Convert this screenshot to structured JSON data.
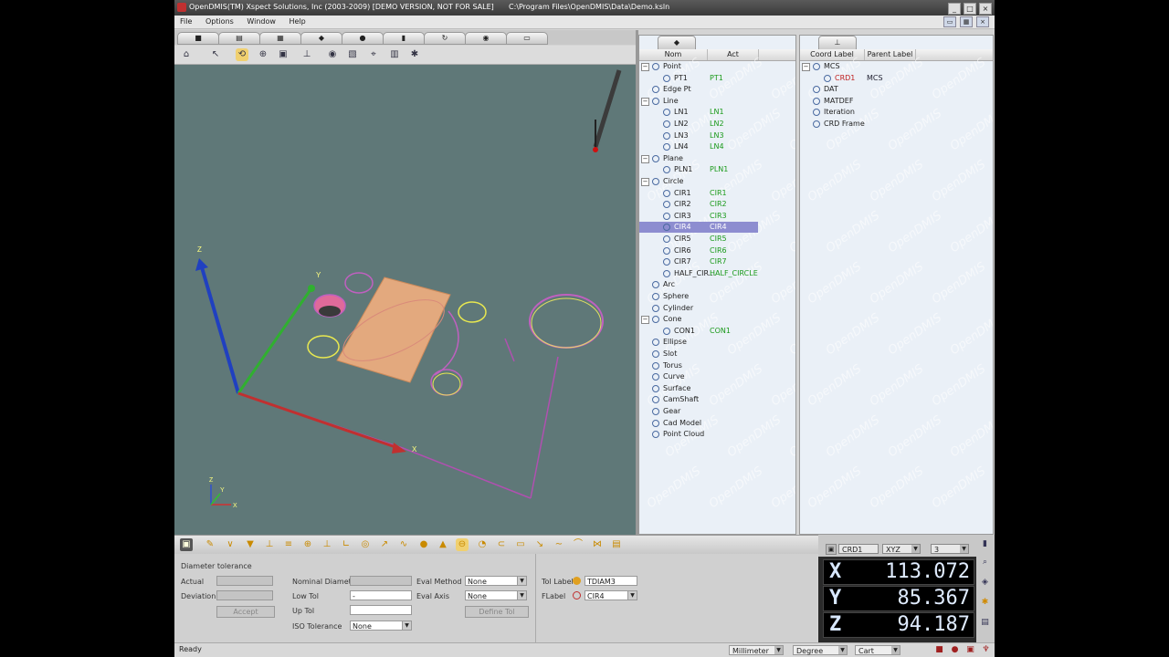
{
  "window": {
    "title": "OpenDMIS(TM)  Xspect Solutions, Inc  (2003-2009) [DEMO VERSION, NOT FOR SALE]",
    "path": "C:\\Program Files\\OpenDMIS\\Data\\Demo.ksln"
  },
  "menu": {
    "file": "File",
    "options": "Options",
    "window": "Window",
    "help": "Help"
  },
  "viewport": {
    "background": "#5f7878",
    "axis_labels": {
      "x": "X",
      "y": "Y",
      "z": "Z"
    }
  },
  "features_panel": {
    "col_name": "Nom",
    "col_act": "Act",
    "watermark": "OpenDMIS",
    "rows": [
      {
        "label": "Point",
        "act": "",
        "level": 0,
        "icon": "point-icon"
      },
      {
        "label": "PT1",
        "act": "PT1",
        "level": 1
      },
      {
        "label": "Edge Pt",
        "act": "",
        "level": 0,
        "icon": "edge-point-icon"
      },
      {
        "label": "Line",
        "act": "",
        "level": 0,
        "icon": "line-icon"
      },
      {
        "label": "LN1",
        "act": "LN1",
        "level": 1
      },
      {
        "label": "LN2",
        "act": "LN2",
        "level": 1
      },
      {
        "label": "LN3",
        "act": "LN3",
        "level": 1
      },
      {
        "label": "LN4",
        "act": "LN4",
        "level": 1
      },
      {
        "label": "Plane",
        "act": "",
        "level": 0,
        "icon": "plane-icon"
      },
      {
        "label": "PLN1",
        "act": "PLN1",
        "level": 1
      },
      {
        "label": "Circle",
        "act": "",
        "level": 0,
        "icon": "circle-icon"
      },
      {
        "label": "CIR1",
        "act": "CIR1",
        "level": 1
      },
      {
        "label": "CIR2",
        "act": "CIR2",
        "level": 1
      },
      {
        "label": "CIR3",
        "act": "CIR3",
        "level": 1
      },
      {
        "label": "CIR4",
        "act": "CIR4",
        "level": 1,
        "selected": true
      },
      {
        "label": "CIR5",
        "act": "CIR5",
        "level": 1
      },
      {
        "label": "CIR6",
        "act": "CIR6",
        "level": 1
      },
      {
        "label": "CIR7",
        "act": "CIR7",
        "level": 1
      },
      {
        "label": "HALF_CIR...",
        "act": "HALF_CIRCLE",
        "level": 1
      },
      {
        "label": "Arc",
        "act": "",
        "level": 0,
        "icon": "arc-icon"
      },
      {
        "label": "Sphere",
        "act": "",
        "level": 0,
        "icon": "sphere-icon"
      },
      {
        "label": "Cylinder",
        "act": "",
        "level": 0,
        "icon": "cylinder-icon"
      },
      {
        "label": "Cone",
        "act": "",
        "level": 0,
        "icon": "cone-icon"
      },
      {
        "label": "CON1",
        "act": "CON1",
        "level": 1
      },
      {
        "label": "Ellipse",
        "act": "",
        "level": 0,
        "icon": "ellipse-icon"
      },
      {
        "label": "Slot",
        "act": "",
        "level": 0,
        "icon": "slot-icon"
      },
      {
        "label": "Torus",
        "act": "",
        "level": 0,
        "icon": "torus-icon"
      },
      {
        "label": "Curve",
        "act": "",
        "level": 0,
        "icon": "curve-icon"
      },
      {
        "label": "Surface",
        "act": "",
        "level": 0,
        "icon": "surface-icon"
      },
      {
        "label": "CamShaft",
        "act": "",
        "level": 0,
        "icon": "camshaft-icon"
      },
      {
        "label": "Gear",
        "act": "",
        "level": 0,
        "icon": "gear-icon"
      },
      {
        "label": "Cad Model",
        "act": "",
        "level": 0,
        "icon": "cad-model-icon"
      },
      {
        "label": "Point Cloud",
        "act": "",
        "level": 0,
        "icon": "point-cloud-icon"
      }
    ]
  },
  "coord_panel": {
    "col_label": "Coord Label",
    "col_parent": "Parent Label",
    "rows": [
      {
        "label": "MCS",
        "parent": "",
        "level": 0
      },
      {
        "label": "CRD1",
        "parent": "MCS",
        "level": 1
      },
      {
        "label": "DAT",
        "parent": "",
        "level": 0
      },
      {
        "label": "MATDEF",
        "parent": "",
        "level": 0
      },
      {
        "label": "Iteration",
        "parent": "",
        "level": 0
      },
      {
        "label": "CRD Frame",
        "parent": "",
        "level": 0
      }
    ]
  },
  "tolerance": {
    "section_title": "Diameter tolerance",
    "actual_label": "Actual",
    "deviation_label": "Deviation",
    "accept_label": "Accept",
    "nominal_label": "Nominal Diameter",
    "low_tol_label": "Low Tol",
    "low_tol_value": "-",
    "up_tol_label": "Up Tol",
    "iso_label": "ISO Tolerance",
    "iso_value": "None",
    "eval_method_label": "Eval Method",
    "eval_method_value": "None",
    "eval_axis_label": "Eval Axis",
    "eval_axis_value": "None",
    "define_tol_label": "Define Tol",
    "tol_label_label": "Tol Label",
    "tol_label_value": "TDIAM3",
    "flabel_label": "FLabel",
    "flabel_value": "CIR4"
  },
  "dro": {
    "crd": "CRD1",
    "mode": "XYZ",
    "decimals": "3",
    "x_label": "X",
    "x": "113.072",
    "y_label": "Y",
    "y": "85.367",
    "z_label": "Z",
    "z": "94.187"
  },
  "status": {
    "text": "Ready",
    "units": "Millimeter",
    "angle": "Degree",
    "coord": "Cart"
  }
}
